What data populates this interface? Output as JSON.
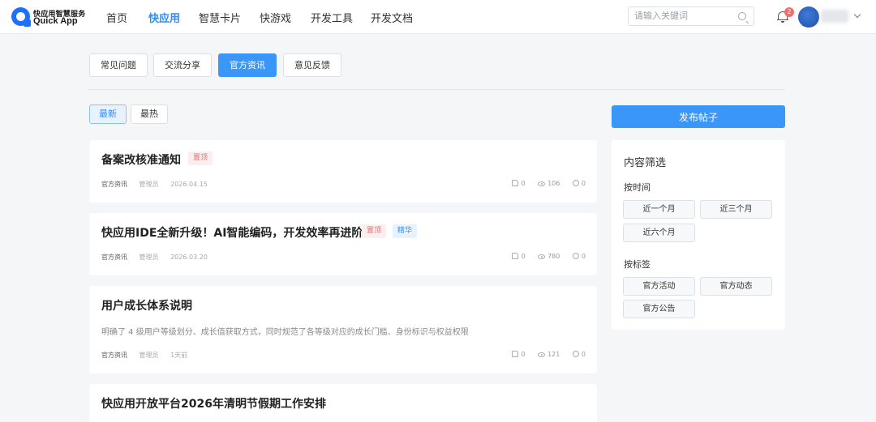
{
  "header": {
    "logo_cn": "快应用智慧服务",
    "logo_en": "Quick App",
    "nav": [
      {
        "label": "首页",
        "active": false
      },
      {
        "label": "快应用",
        "active": true
      },
      {
        "label": "智慧卡片",
        "active": false
      },
      {
        "label": "快游戏",
        "active": false
      },
      {
        "label": "开发工具",
        "active": false
      },
      {
        "label": "开发文档",
        "active": false
      }
    ],
    "search_placeholder": "请输入关键词",
    "notification_count": "2"
  },
  "categories": [
    {
      "label": "常见问题",
      "active": false
    },
    {
      "label": "交流分享",
      "active": false
    },
    {
      "label": "官方资讯",
      "active": true
    },
    {
      "label": "意见反馈",
      "active": false
    }
  ],
  "sort": [
    {
      "label": "最新",
      "active": true
    },
    {
      "label": "最热",
      "active": false
    }
  ],
  "posts": [
    {
      "title": "备案改核准通知",
      "tags": [
        "置顶"
      ],
      "description": "",
      "category": "官方资讯",
      "author": "管理员",
      "date": "2026.04.15",
      "likes": "0",
      "views": "106",
      "comments": "0"
    },
    {
      "title": "快应用IDE全新升级！AI智能编码，开发效率再进阶！",
      "tags": [
        "置顶",
        "精华"
      ],
      "description": "",
      "category": "官方资讯",
      "author": "管理员",
      "date": "2026.03.20",
      "likes": "0",
      "views": "780",
      "comments": "0"
    },
    {
      "title": "用户成长体系说明",
      "tags": [],
      "description": "明确了 4 级用户等级划分、成长值获取方式，同时规范了各等级对应的成长门槛、身份标识与权益权限",
      "category": "官方资讯",
      "author": "管理员",
      "date": "1天前",
      "likes": "0",
      "views": "121",
      "comments": "0"
    },
    {
      "title": "快应用开放平台2026年清明节假期工作安排",
      "tags": [],
      "description": "",
      "category": "",
      "author": "",
      "date": "",
      "likes": "",
      "views": "",
      "comments": ""
    }
  ],
  "sidebar": {
    "publish_label": "发布帖子",
    "filter_title": "内容筛选",
    "time_label": "按时间",
    "time_options": [
      "近一个月",
      "近三个月",
      "近六个月"
    ],
    "tag_label": "按标签",
    "tag_options": [
      "官方活动",
      "官方动态",
      "官方公告"
    ]
  }
}
